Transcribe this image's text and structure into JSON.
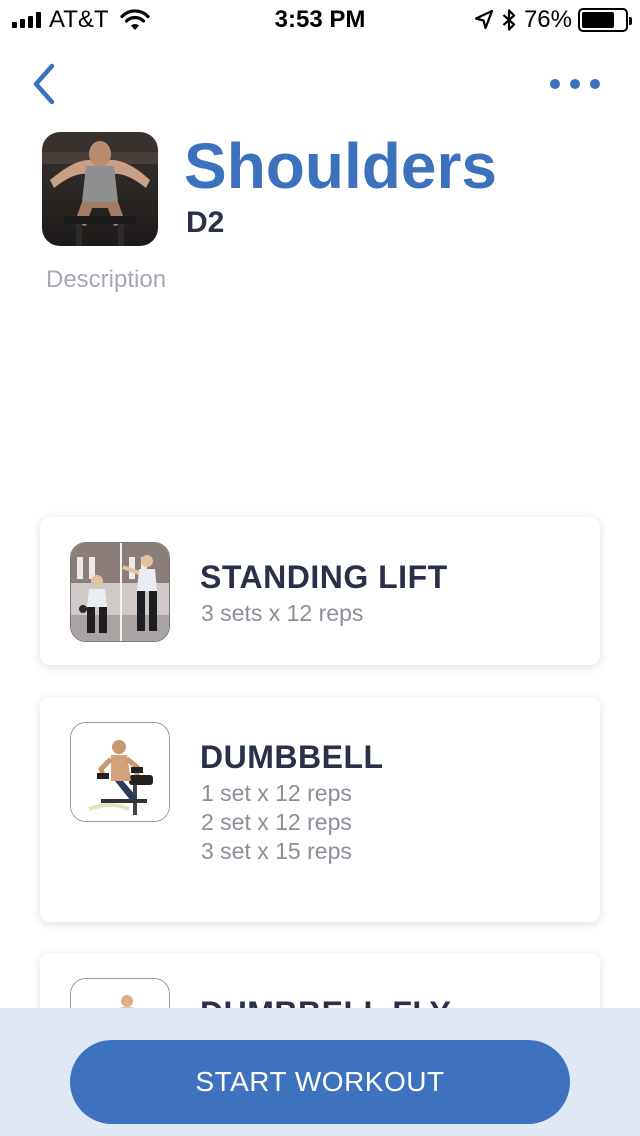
{
  "status_bar": {
    "carrier": "AT&T",
    "time": "3:53 PM",
    "battery_percent": "76%",
    "battery_level": 0.76,
    "icons": [
      "signal-icon",
      "wifi-icon",
      "location-icon",
      "bluetooth-icon",
      "battery-icon"
    ]
  },
  "nav": {
    "back_icon": "chevron-left-icon",
    "more_icon": "more-dots-icon"
  },
  "header": {
    "title": "Shoulders",
    "subtitle": "D2",
    "description_placeholder": "Description"
  },
  "exercises": [
    {
      "name": "STANDING LIFT",
      "lines": [
        "3 sets x 12 reps"
      ]
    },
    {
      "name": "DUMBBELL",
      "lines": [
        "1 set x 12 reps",
        "2 set x 12 reps",
        "3 set x 15 reps"
      ]
    },
    {
      "name": "DUMBBELL FLY",
      "lines": []
    }
  ],
  "footer": {
    "start_label": "START WORKOUT"
  },
  "colors": {
    "accent": "#3b71bd",
    "title_dark": "#2a2f4a",
    "muted": "#8a8f98",
    "footer_bg": "#dfe8f5"
  }
}
